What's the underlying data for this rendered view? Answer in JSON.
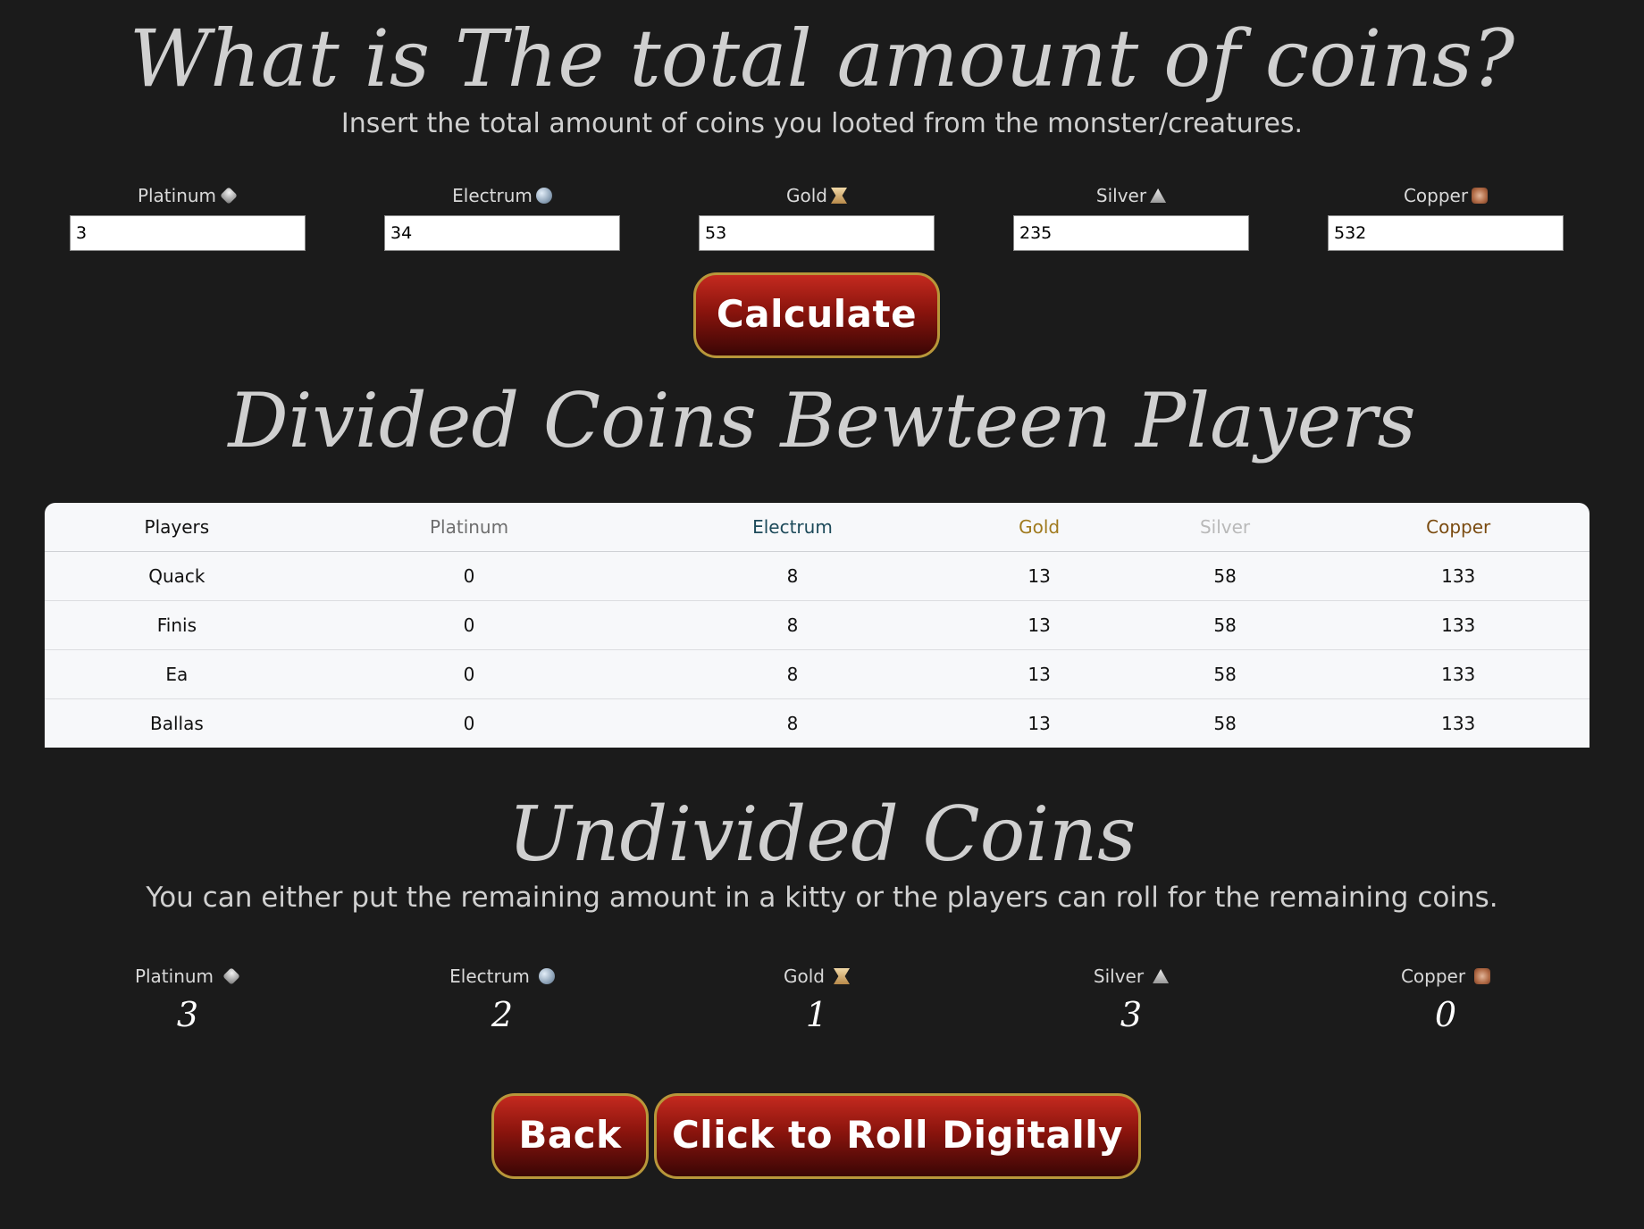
{
  "total_section": {
    "title": "What is The total amount of coins?",
    "subtitle": "Insert the total amount of coins you looted from the monster/creatures.",
    "fields": [
      {
        "label": "Platinum",
        "icon": "platinum-coin-icon",
        "value": "3"
      },
      {
        "label": "Electrum",
        "icon": "electrum-coin-icon",
        "value": "34"
      },
      {
        "label": "Gold",
        "icon": "gold-coin-icon",
        "value": "53"
      },
      {
        "label": "Silver",
        "icon": "silver-coin-icon",
        "value": "235"
      },
      {
        "label": "Copper",
        "icon": "copper-coin-icon",
        "value": "532"
      }
    ],
    "calculate_label": "Calculate"
  },
  "divided_section": {
    "title": "Divided Coins Bewteen Players",
    "headers": [
      "Players",
      "Platinum",
      "Electrum",
      "Gold",
      "Silver",
      "Copper"
    ],
    "header_colors": [
      "#111111",
      "#6e6e6e",
      "#1d4a5a",
      "#a07a1e",
      "#b9b9b9",
      "#7a4b10"
    ],
    "rows": [
      [
        "Quack",
        "0",
        "8",
        "13",
        "58",
        "133"
      ],
      [
        "Finis",
        "0",
        "8",
        "13",
        "58",
        "133"
      ],
      [
        "Ea",
        "0",
        "8",
        "13",
        "58",
        "133"
      ],
      [
        "Ballas",
        "0",
        "8",
        "13",
        "58",
        "133"
      ]
    ]
  },
  "undivided_section": {
    "title": "Undivided Coins",
    "subtitle": "You can either put the remaining amount in a kitty or the players can roll for the remaining coins.",
    "coins": [
      {
        "label": "Platinum",
        "icon": "platinum-coin-icon",
        "value": "3"
      },
      {
        "label": "Electrum",
        "icon": "electrum-coin-icon",
        "value": "2"
      },
      {
        "label": "Gold",
        "icon": "gold-coin-icon",
        "value": "1"
      },
      {
        "label": "Silver",
        "icon": "silver-coin-icon",
        "value": "3"
      },
      {
        "label": "Copper",
        "icon": "copper-coin-icon",
        "value": "0"
      }
    ]
  },
  "buttons": {
    "back_label": "Back",
    "roll_label": "Click to Roll Digitally"
  }
}
